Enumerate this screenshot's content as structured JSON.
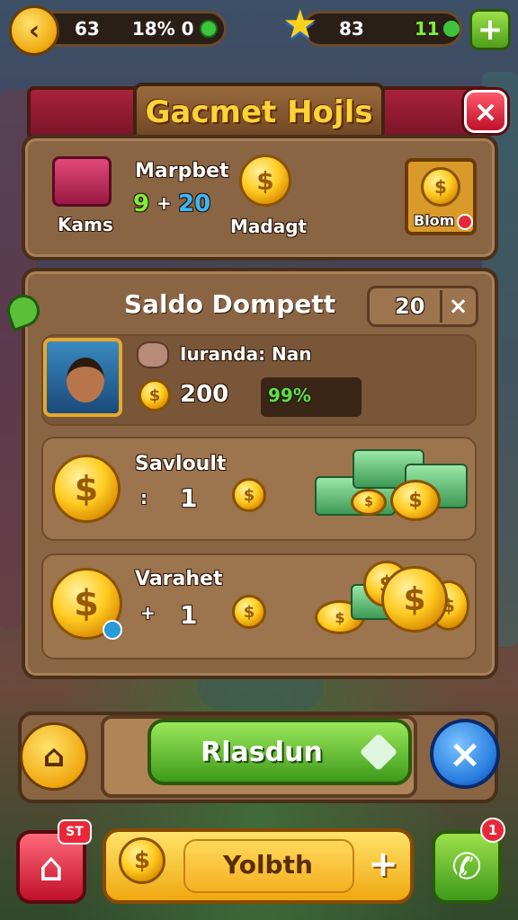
{
  "topbar": {
    "back_icon": "back-arrow-icon",
    "left_value_1": "63",
    "left_value_2": "18% 0",
    "right_value_1": "83",
    "right_value_2": "11",
    "plus_label": "+"
  },
  "dialog": {
    "title": "Gacmet Hojls",
    "close_label": "×",
    "top_panel": {
      "chest_label": "Kams",
      "market_label": "Marpbet",
      "stat_left": "9",
      "stat_op": "+",
      "stat_right": "20",
      "coin_label": "Madagt",
      "store_label": "Blom"
    },
    "wallet": {
      "title": "Saldo Dompett",
      "count": "20",
      "count_close": "×",
      "profile": {
        "name": "Iuranda: Nan",
        "coins": "200",
        "percent": "99%"
      },
      "rows": [
        {
          "label": "Savloult",
          "op": ":",
          "value": "1"
        },
        {
          "label": "Varahet",
          "op": "+",
          "value": "1"
        }
      ]
    }
  },
  "action_bar": {
    "main_label": "Rlasdun",
    "cancel_label": "×"
  },
  "bottom_bar": {
    "home_badge": "ST",
    "center_label": "Yolbth",
    "plus_label": "+",
    "phone_badge": "1"
  },
  "colors": {
    "wood": "#8a6544",
    "banner_red": "#a8223a",
    "title_gold": "#ffd23a",
    "action_green": "#5cc02a",
    "cancel_blue": "#2a7ee0"
  }
}
